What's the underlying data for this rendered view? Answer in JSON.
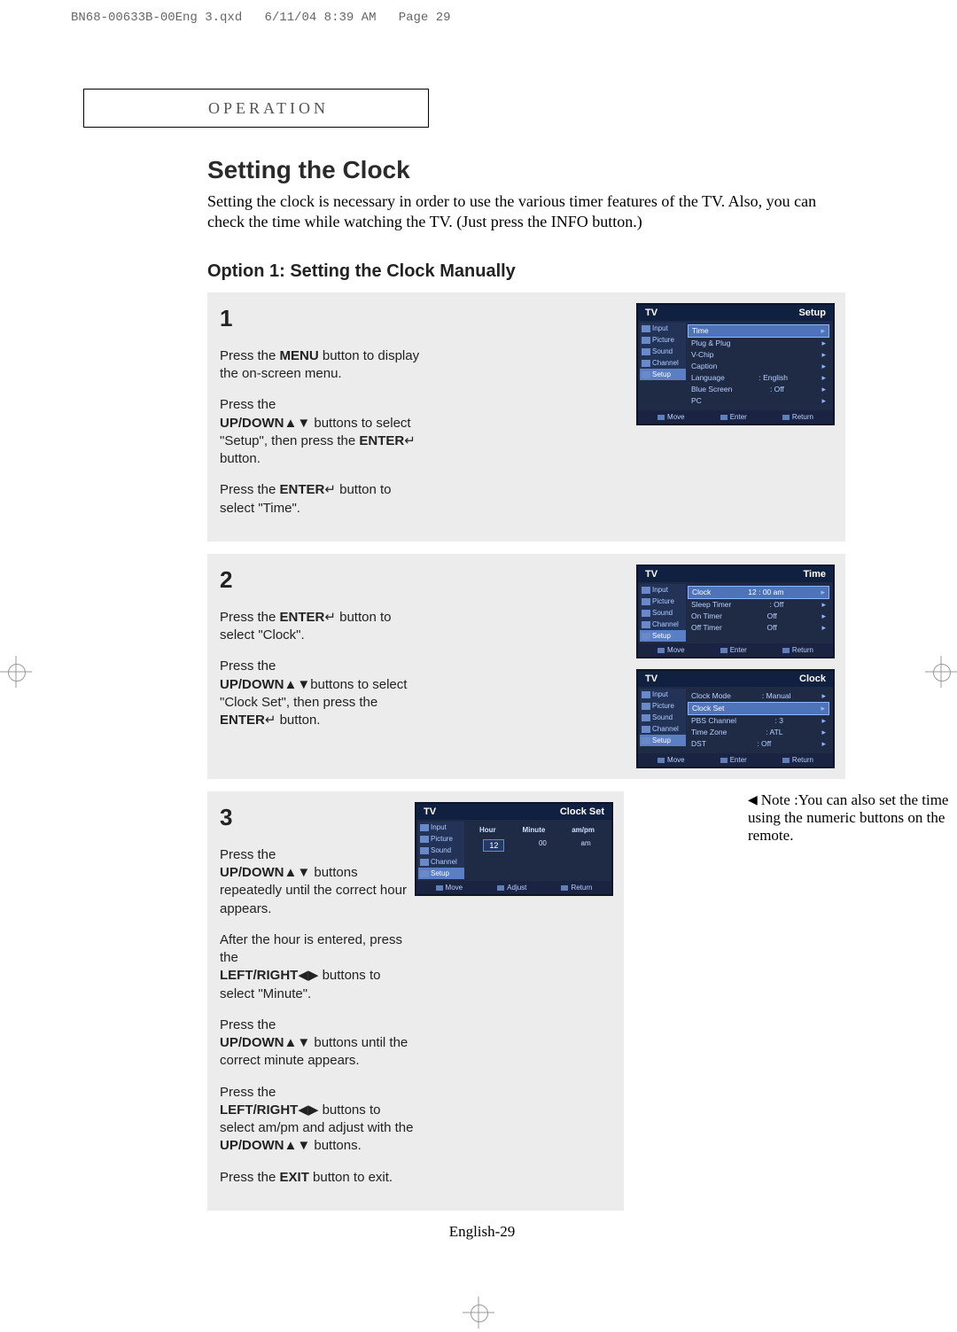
{
  "print_header": {
    "file": "BN68-00633B-00Eng 3.qxd",
    "date": "6/11/04 8:39 AM",
    "page_label": "Page 29"
  },
  "section_tab": "OPERATION",
  "title": "Setting the Clock",
  "intro": "Setting the clock is  necessary in order to use the various timer features of the TV. Also, you can check the time while watching the TV. (Just press the INFO button.)",
  "option_heading": "Option 1: Setting the Clock Manually",
  "sidebar_items": [
    "Input",
    "Picture",
    "Sound",
    "Channel",
    "Setup"
  ],
  "footer_labels": {
    "move": "Move",
    "enter": "Enter",
    "return": "Return",
    "adjust": "Adjust"
  },
  "step1": {
    "num": "1",
    "para1_line1": "Press the ",
    "para1_bold1": "MENU",
    "para1_line2": " button to display the on-screen menu.",
    "para2_line1": "Press the ",
    "para2_bold1": "UP/DOWN",
    "para2_glyph1": "▲▼",
    "para2_line2": " buttons to select \"Setup\", then press the ",
    "para2_bold2": "ENTER",
    "para2_glyph2": "↵",
    "para2_line3": " button.",
    "para3_line1": "Press the ",
    "para3_bold1": "ENTER",
    "para3_glyph1": "↵",
    "para3_line2": " button to select \"Time\".",
    "tv": {
      "tl": "TV",
      "tr": "Setup",
      "rows": [
        {
          "l": "Time",
          "r": "▸",
          "sel": true
        },
        {
          "l": "Plug & Plug",
          "r": "▸"
        },
        {
          "l": "V-Chip",
          "r": "▸"
        },
        {
          "l": "Caption",
          "r": "▸"
        },
        {
          "l": "Language",
          "m": ":   English",
          "r": "▸"
        },
        {
          "l": "Blue Screen",
          "m": ":   Off",
          "r": "▸"
        },
        {
          "l": "PC",
          "r": "▸"
        }
      ]
    }
  },
  "step2": {
    "num": "2",
    "para1_line1": "Press the ",
    "para1_bold1": "ENTER",
    "para1_glyph1": "↵",
    "para1_line2": " button to select \"Clock\".",
    "para2_line1": "Press the ",
    "para2_bold1": "UP/DOWN",
    "para2_glyph1": "▲▼",
    "para2_line2": "buttons to select \"Clock Set\", then press the ",
    "para2_bold2": "ENTER",
    "para2_glyph2": "↵",
    "para2_line3": "  button.",
    "tv_a": {
      "tl": "TV",
      "tr": "Time",
      "rows": [
        {
          "l": "Clock",
          "m": "12 : 00  am",
          "r": "▸",
          "sel": true
        },
        {
          "l": "Sleep Timer",
          "m": ":   Off",
          "r": "▸"
        },
        {
          "l": "On Timer",
          "m": "Off",
          "r": "▸"
        },
        {
          "l": "Off Timer",
          "m": "Off",
          "r": "▸"
        }
      ]
    },
    "tv_b": {
      "tl": "TV",
      "tr": "Clock",
      "rows": [
        {
          "l": "Clock Mode",
          "m": ":   Manual",
          "r": "▸"
        },
        {
          "l": "Clock Set",
          "r": "▸",
          "sel": true
        },
        {
          "l": "PBS Channel",
          "m": ":   3",
          "r": "▸"
        },
        {
          "l": "Time Zone",
          "m": ":   ATL",
          "r": "▸"
        },
        {
          "l": "DST",
          "m": ":   Off",
          "r": "▸"
        }
      ]
    }
  },
  "step3": {
    "num": "3",
    "p1_a": "Press the ",
    "p1_b": "UP/DOWN",
    "p1_g": "▲▼",
    "p1_c": " buttons repeatedly until the correct hour appears.",
    "p2_a": "After the hour is entered, press the ",
    "p2_b": "LEFT/RIGHT",
    "p2_g": "◀▶",
    "p2_c": " buttons to select \"Minute\".",
    "p3_a": "Press the ",
    "p3_b": "UP/DOWN",
    "p3_g": "▲▼",
    "p3_c": " buttons until the correct minute appears.",
    "p4_a": "Press the ",
    "p4_b": "LEFT/RIGHT",
    "p4_g": "◀▶",
    "p4_c": " buttons to select am/pm and adjust with the ",
    "p4_d": "UP/DOWN",
    "p4_g2": "▲▼",
    "p4_e": " buttons.",
    "p5_a": "Press the ",
    "p5_b": "EXIT",
    "p5_c": " button to exit.",
    "tv": {
      "tl": "TV",
      "tr": "Clock Set",
      "headers": [
        "Hour",
        "Minute",
        "am/pm"
      ],
      "vals": [
        "12",
        "00",
        "am"
      ]
    }
  },
  "note": {
    "pointer": "◀",
    "text": "Note :You can also set the time using the numeric buttons on the remote."
  },
  "page_number": "English-29"
}
